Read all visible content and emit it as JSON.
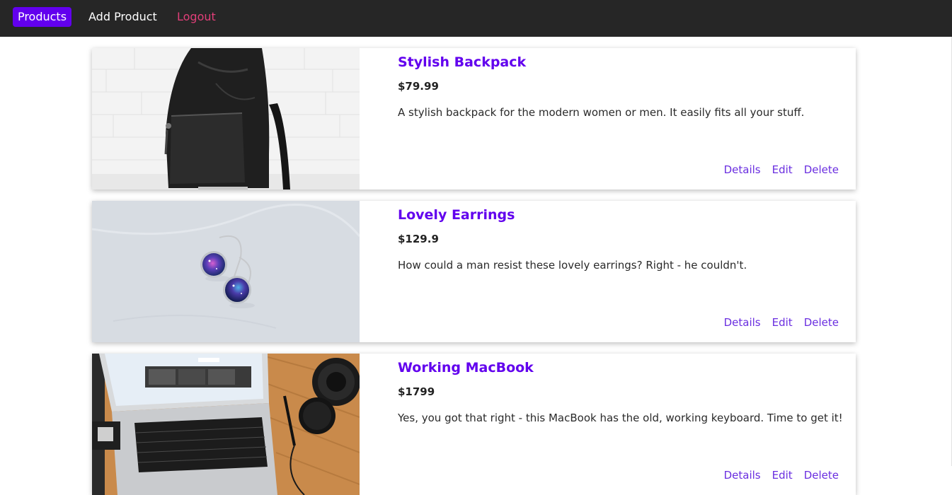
{
  "nav": {
    "products_label": "Products",
    "add_product_label": "Add Product",
    "logout_label": "Logout"
  },
  "colors": {
    "accent": "#6200ee",
    "navbar_bg": "#262626",
    "logout": "#e23f79"
  },
  "products": [
    {
      "title": "Stylish Backpack",
      "price": "$79.99",
      "description": "A stylish backpack for the modern women or men. It easily fits all your stuff.",
      "image_subject": "backpack",
      "actions": {
        "details": "Details",
        "edit": "Edit",
        "delete": "Delete"
      }
    },
    {
      "title": "Lovely Earrings",
      "price": "$129.9",
      "description": "How could a man resist these lovely earrings? Right - he couldn't.",
      "image_subject": "earrings",
      "actions": {
        "details": "Details",
        "edit": "Edit",
        "delete": "Delete"
      }
    },
    {
      "title": "Working MacBook",
      "price": "$1799",
      "description": "Yes, you got that right - this MacBook has the old, working keyboard. Time to get it!",
      "image_subject": "laptop",
      "actions": {
        "details": "Details",
        "edit": "Edit",
        "delete": "Delete"
      }
    }
  ]
}
